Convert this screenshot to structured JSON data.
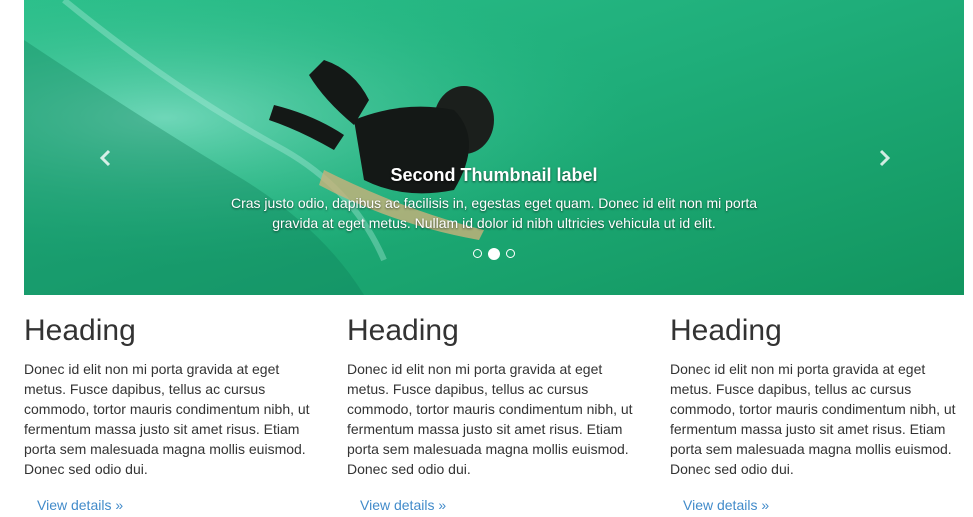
{
  "carousel": {
    "caption_title": "Second Thumbnail label",
    "caption_text": "Cras justo odio, dapibus ac facilisis in, egestas eget quam. Donec id elit non mi porta gravida at eget metus. Nullam id dolor id nibh ultricies vehicula ut id elit.",
    "prev_icon": "chevron-left-icon",
    "next_icon": "chevron-right-icon",
    "indicator_count": 3,
    "active_indicator": 2
  },
  "columns": [
    {
      "heading": "Heading",
      "text": "Donec id elit non mi porta gravida at eget metus. Fusce dapibus, tellus ac cursus commodo, tortor mauris condimentum nibh, ut fermentum massa justo sit amet risus. Etiam porta sem malesuada magna mollis euismod. Donec sed odio dui.",
      "link": "View details »"
    },
    {
      "heading": "Heading",
      "text": "Donec id elit non mi porta gravida at eget metus. Fusce dapibus, tellus ac cursus commodo, tortor mauris condimentum nibh, ut fermentum massa justo sit amet risus. Etiam porta sem malesuada magna mollis euismod. Donec sed odio dui.",
      "link": "View details »"
    },
    {
      "heading": "Heading",
      "text": "Donec id elit non mi porta gravida at eget metus. Fusce dapibus, tellus ac cursus commodo, tortor mauris condimentum nibh, ut fermentum massa justo sit amet risus. Etiam porta sem malesuada magna mollis euismod. Donec sed odio dui.",
      "link": "View details »"
    }
  ],
  "colors": {
    "link": "#428bca",
    "text": "#333333",
    "water": "#1aa56f"
  }
}
